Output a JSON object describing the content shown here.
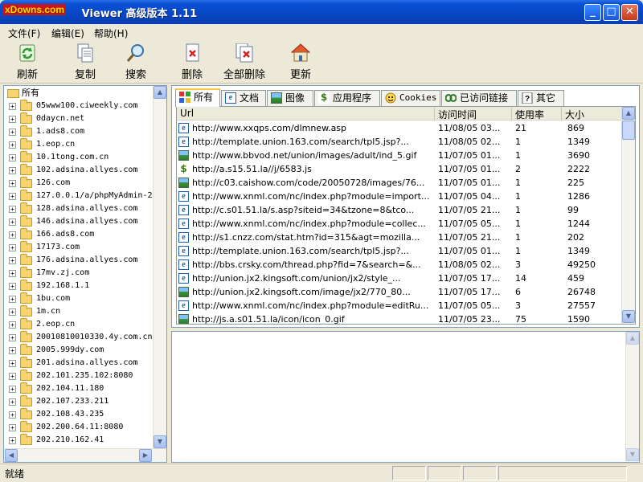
{
  "window": {
    "logo_text": "xDowns.com",
    "title": "       Viewer 高级版本 1.11",
    "buttons": [
      "_",
      "□",
      "✕"
    ]
  },
  "menu": [
    {
      "label": "文件(F)"
    },
    {
      "label": "编辑(E)"
    },
    {
      "label": "帮助(H)"
    }
  ],
  "toolbar": {
    "refresh": "刷新",
    "copy": "复制",
    "search": "搜索",
    "delete": "删除",
    "delete_all": "全部删除",
    "update": "更新"
  },
  "tree": {
    "root": "所有",
    "items": [
      "05www100.ciweekly.com",
      "0daycn.net",
      "1.ads8.com",
      "1.eop.cn",
      "10.1tong.com.cn",
      "102.adsina.allyes.com",
      "126.com",
      "127.0.0.1/a/phpMyAdmin-2",
      "128.adsina.allyes.com",
      "146.adsina.allyes.com",
      "166.ads8.com",
      "17173.com",
      "176.adsina.allyes.com",
      "17mv.zj.com",
      "192.168.1.1",
      "1bu.com",
      "1m.cn",
      "2.eop.cn",
      "20010810010330.4y.com.cn",
      "2005.999dy.com",
      "201.adsina.allyes.com",
      "202.101.235.102:8080",
      "202.104.11.180",
      "202.107.233.211",
      "202.108.43.235",
      "202.200.64.11:8080",
      "202.210.162.41"
    ]
  },
  "tabs": [
    "所有",
    "文档",
    "图像",
    "应用程序",
    "Cookies",
    "已访问链接",
    "其它"
  ],
  "table": {
    "columns": [
      "Url",
      "访问时间",
      "使用率",
      "大小"
    ],
    "rows": [
      {
        "icon": "ie",
        "url": "http://www.xxqps.com/dlmnew.asp",
        "time": "11/08/05 03...",
        "usage": "21",
        "size": "869"
      },
      {
        "icon": "ie",
        "url": "http://template.union.163.com/search/tpl5.jsp?...",
        "time": "11/08/05 02...",
        "usage": "1",
        "size": "1349"
      },
      {
        "icon": "img",
        "url": "http://www.bbvod.net/union/images/adult/ind_5.gif",
        "time": "11/07/05 01...",
        "usage": "1",
        "size": "3690"
      },
      {
        "icon": "js",
        "url": "http://a.s15.51.la//j/6583.js",
        "time": "11/07/05 01...",
        "usage": "2",
        "size": "2222"
      },
      {
        "icon": "img",
        "url": "http://c03.caishow.com/code/20050728/images/76...",
        "time": "11/07/05 01...",
        "usage": "1",
        "size": "225"
      },
      {
        "icon": "ie",
        "url": "http://www.xnml.com/nc/index.php?module=import...",
        "time": "11/07/05 04...",
        "usage": "1",
        "size": "1286"
      },
      {
        "icon": "ie",
        "url": "http://c.s01.51.la/s.asp?siteid=34&tzone=8&tco...",
        "time": "11/07/05 21...",
        "usage": "1",
        "size": "99"
      },
      {
        "icon": "ie",
        "url": "http://www.xnml.com/nc/index.php?module=collec...",
        "time": "11/07/05 05...",
        "usage": "1",
        "size": "1244"
      },
      {
        "icon": "ie",
        "url": "http://s1.cnzz.com/stat.htm?id=315&agt=mozilla...",
        "time": "11/07/05 21...",
        "usage": "1",
        "size": "202"
      },
      {
        "icon": "ie",
        "url": "http://template.union.163.com/search/tpl5.jsp?...",
        "time": "11/07/05 01...",
        "usage": "1",
        "size": "1349"
      },
      {
        "icon": "ie",
        "url": "http://bbs.crsky.com/thread.php?fid=7&search=&...",
        "time": "11/08/05 02...",
        "usage": "3",
        "size": "49250"
      },
      {
        "icon": "ie",
        "url": "http://union.jx2.kingsoft.com/union/jx2/style_...",
        "time": "11/07/05 17...",
        "usage": "14",
        "size": "459"
      },
      {
        "icon": "img",
        "url": "http://union.jx2.kingsoft.com/image/jx2/770_80...",
        "time": "11/07/05 17...",
        "usage": "6",
        "size": "26748"
      },
      {
        "icon": "ie",
        "url": "http://www.xnml.com/nc/index.php?module=editRu...",
        "time": "11/07/05 05...",
        "usage": "3",
        "size": "27557"
      },
      {
        "icon": "img",
        "url": "http://js.a.s01.51.la/icon/icon_0.gif",
        "time": "11/07/05 23...",
        "usage": "75",
        "size": "1590"
      }
    ]
  },
  "status": {
    "text": "就绪"
  }
}
